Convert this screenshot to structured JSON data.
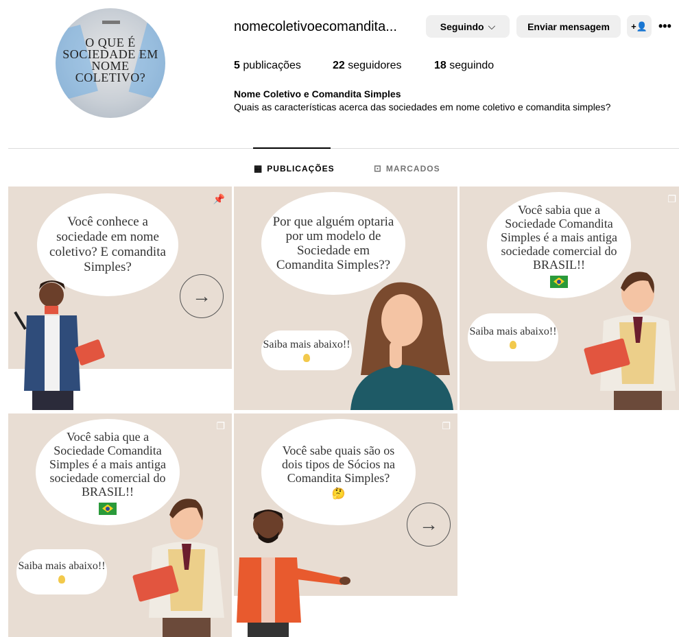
{
  "profile": {
    "avatar_text": "O QUE É SOCIEDADE EM NOME COLETIVO?",
    "username": "nomecoletivoecomandita...",
    "following_button": "Seguindo",
    "message_button": "Enviar mensagem",
    "add_user_icon": "+👤",
    "more_icon": "•••",
    "posts_count": "5",
    "posts_label": "publicações",
    "followers_count": "22",
    "followers_label": "seguidores",
    "following_count": "18",
    "following_label": "seguindo",
    "full_name": "Nome Coletivo e Comandita Simples",
    "bio": "Quais as características acerca das sociedades em nome coletivo e comandita simples?"
  },
  "tabs": [
    {
      "label": "PUBLICAÇÕES",
      "icon": "grid-icon",
      "active": true
    },
    {
      "label": "MARCADOS",
      "icon": "tag-icon",
      "active": false
    }
  ],
  "posts": [
    {
      "text": "Você conhece a sociedade em nome coletivo? E comandita Simples?",
      "icon": "pin-icon"
    },
    {
      "text": "Por que alguém optaria por um modelo de Sociedade em Comandita Simples??",
      "cta": "Saiba mais abaixo!!"
    },
    {
      "text": "Você sabia que a Sociedade Comandita Simples é a mais antiga sociedade comercial do BRASIL!!",
      "cta": "Saiba mais abaixo!!",
      "icon": "carousel-icon"
    },
    {
      "text": "Você sabia que a Sociedade Comandita Simples é a mais antiga sociedade comercial do BRASIL!!",
      "cta": "Saiba mais abaixo!!",
      "icon": "carousel-icon"
    },
    {
      "text": "Você sabe quais são os dois tipos de Sócios na Comandita Simples?",
      "emoji": "🤔",
      "icon": "carousel-icon"
    }
  ],
  "colors": {
    "post_bg": "#e8ddd3",
    "accent_blue": "#5aa6e6"
  }
}
